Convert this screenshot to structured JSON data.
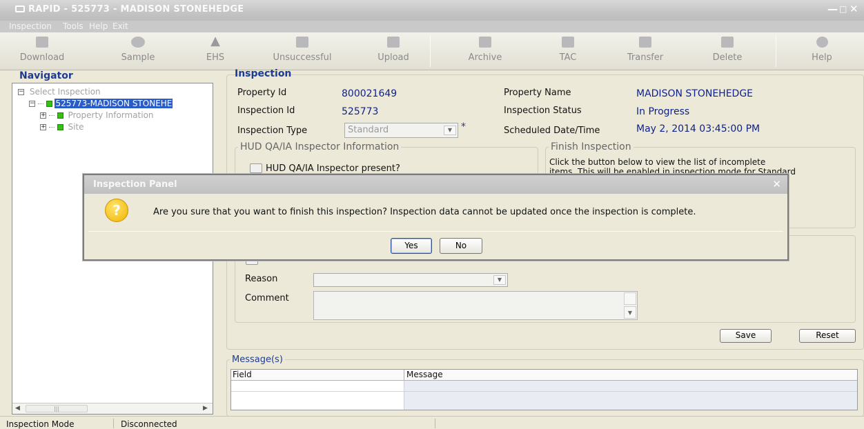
{
  "window": {
    "title": "RAPID - 525773 - MADISON STONEHEDGE",
    "controls": [
      "minimize",
      "maximize",
      "close"
    ]
  },
  "menu": [
    "Inspection",
    "Tools",
    "Help",
    "Exit"
  ],
  "toolbar": {
    "buttons": [
      {
        "label": "Download",
        "icon": "download-icon"
      },
      {
        "label": "Sample",
        "icon": "sample-icon"
      },
      {
        "label": "EHS",
        "icon": "warning-icon"
      },
      {
        "label": "Unsuccessful",
        "icon": "unsuccessful-icon"
      },
      {
        "label": "Upload",
        "icon": "upload-icon"
      },
      {
        "label": "Archive",
        "icon": "archive-icon"
      },
      {
        "label": "TAC",
        "icon": "tac-icon"
      },
      {
        "label": "Transfer",
        "icon": "transfer-icon"
      },
      {
        "label": "Delete",
        "icon": "delete-icon"
      },
      {
        "label": "Help",
        "icon": "help-icon"
      }
    ]
  },
  "navigator": {
    "title": "Navigator",
    "tree": [
      {
        "label": "Select Inspection",
        "expander": "−"
      },
      {
        "label": "525773-MADISON STONEHE",
        "expander": "−"
      },
      {
        "label": "Property Information",
        "expander": "+"
      },
      {
        "label": "Site",
        "expander": "+"
      }
    ]
  },
  "inspection": {
    "title": "Inspection",
    "property_id_label": "Property Id",
    "property_id": "800021649",
    "property_name_label": "Property Name",
    "property_name": "MADISON STONEHEDGE",
    "inspection_id_label": "Inspection Id",
    "inspection_id": "525773",
    "status_label": "Inspection Status",
    "status": "In Progress",
    "type_label": "Inspection Type",
    "type_value": "Standard",
    "required_marker": "*",
    "scheduled_label": "Scheduled Date/Time",
    "scheduled_value": "May 2, 2014 03:45:00 PM",
    "hud_group_title": "HUD QA/IA Inspector Information",
    "hud_checkbox_label": "HUD QA/IA Inspector present?",
    "finish_group_title": "Finish Inspection",
    "finish_text_1": "Click the button below to view the list of incomplete",
    "finish_text_2": "items. This will be enabled in inspection mode for Standard",
    "reason_label": "Reason",
    "comment_label": "Comment",
    "save_label": "Save",
    "reset_label": "Reset"
  },
  "messages": {
    "title": "Message(s)",
    "columns": [
      "Field",
      "Message"
    ]
  },
  "status_bar": {
    "mode": "Inspection Mode",
    "connection": "Disconnected"
  },
  "dialog": {
    "title": "Inspection Panel",
    "icon": "question-icon",
    "message": "Are you sure that you want to finish this inspection? Inspection data cannot be updated once the inspection is complete.",
    "yes_label": "Yes",
    "no_label": "No"
  },
  "colors": {
    "accent_blue": "#1c3c94",
    "value_blue": "#10228a",
    "tree_selected": "#2a5cc8",
    "node_green": "#37c012"
  }
}
